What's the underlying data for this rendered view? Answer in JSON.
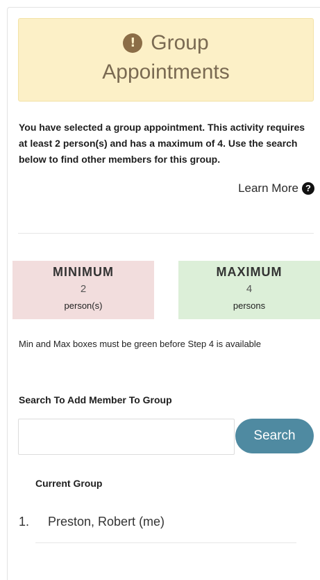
{
  "alert": {
    "icon": "exclamation-circle-icon",
    "title_line1": "Group",
    "title_line2": "Appointments"
  },
  "intro_text": "You have selected a group appointment. This activity requires at least 2 person(s) and has a maximum of 4. Use the search below to find other members for this group.",
  "learn_more": {
    "label": "Learn More",
    "icon": "question-circle-icon"
  },
  "limits": {
    "minimum": {
      "title": "MINIMUM",
      "value": "2",
      "unit": "person(s)",
      "color": "#f2dddd"
    },
    "maximum": {
      "title": "MAXIMUM",
      "value": "4",
      "unit": "persons",
      "color": "#dcefd8"
    }
  },
  "note": "Min and Max boxes must be green before Step 4 is available",
  "search": {
    "label": "Search To Add Member To Group",
    "input_value": "",
    "button_label": "Search",
    "button_color": "#4f8aa1"
  },
  "current_group": {
    "heading": "Current Group",
    "members": [
      {
        "number": "1.",
        "name": "Preston, Robert (me)"
      }
    ]
  }
}
